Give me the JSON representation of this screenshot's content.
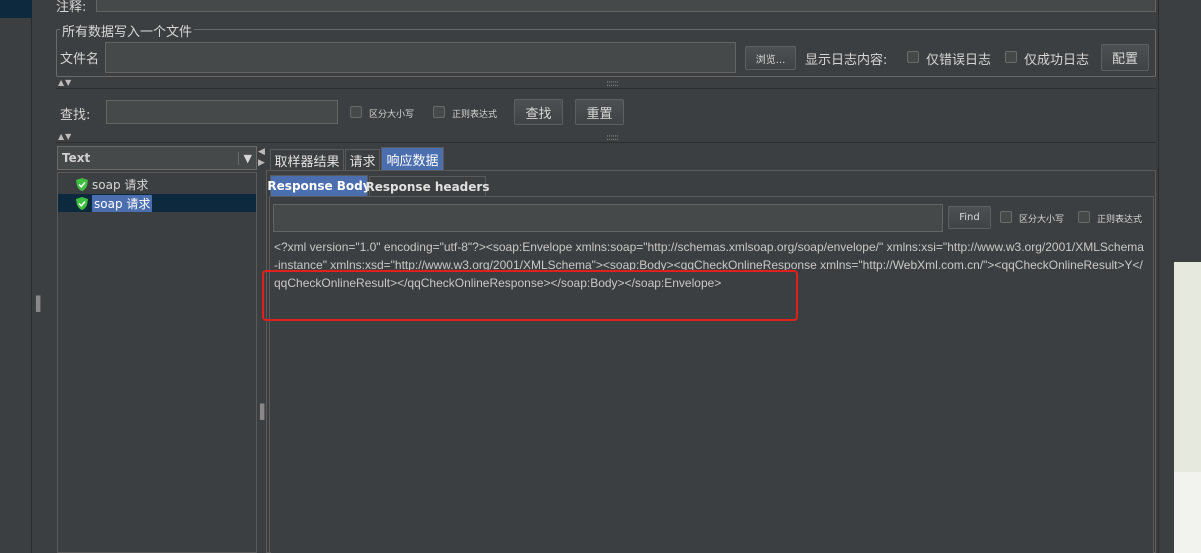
{
  "top": {
    "comment_label": "注释:"
  },
  "file_group": {
    "legend": "所有数据写入一个文件",
    "filename_label": "文件名",
    "filename_value": "",
    "browse_label": "浏览...",
    "log_content_label": "显示日志内容:",
    "errors_only_label": "仅错误日志",
    "success_only_label": "仅成功日志",
    "config_label": "配置"
  },
  "search": {
    "label": "查找:",
    "value": "",
    "case_label": "区分大小写",
    "regex_label": "正则表达式",
    "find_label": "查找",
    "reset_label": "重置"
  },
  "tree": {
    "renderer_selected": "Text",
    "items": [
      {
        "label": "soap 请求",
        "status": "success"
      },
      {
        "label": "soap 请求",
        "status": "success",
        "selected": true
      }
    ]
  },
  "result_tabs": [
    "取样器结果",
    "请求",
    "响应数据"
  ],
  "response_tabs": [
    "Response Body",
    "Response headers"
  ],
  "response_find": {
    "value": "",
    "find_label": "Find",
    "case_label": "区分大小写",
    "regex_label": "正则表达式"
  },
  "response_body": "<?xml version=\"1.0\" encoding=\"utf-8\"?><soap:Envelope xmlns:soap=\"http://schemas.xmlsoap.org/soap/envelope/\" xmlns:xsi=\"http://www.w3.org/2001/XMLSchema-instance\" xmlns:xsd=\"http://www.w3.org/2001/XMLSchema\"><soap:Body><qqCheckOnlineResponse xmlns=\"http://WebXml.com.cn/\"><qqCheckOnlineResult>Y</qqCheckOnlineResult></qqCheckOnlineResponse></soap:Body></soap:Envelope>",
  "icons": {
    "collapse": "collapse-arrows-icon",
    "success": "success-shield-icon",
    "dropdown": "chevron-down-icon",
    "splitter": "splitter-grip-icon"
  },
  "colors": {
    "background": "#3c3f41",
    "selection": "#4b6eaf",
    "success_green": "#3fbf3f",
    "highlight_red": "#e0201a"
  }
}
